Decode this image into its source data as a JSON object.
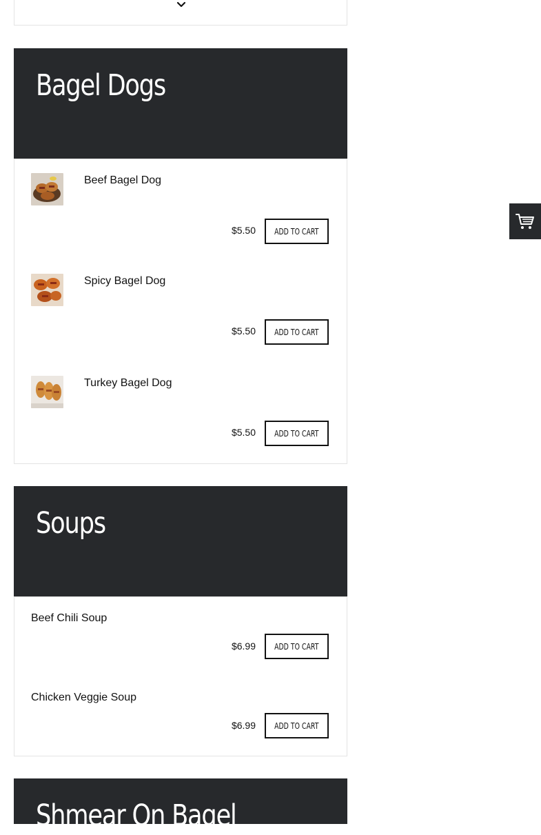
{
  "sections": [
    {
      "title": "Bagel Dogs",
      "items": [
        {
          "name": "Beef Bagel Dog",
          "price": "$5.50",
          "button": "ADD TO CART",
          "thumb": "beef-bagel-dog-thumbnail"
        },
        {
          "name": "Spicy Bagel Dog",
          "price": "$5.50",
          "button": "ADD TO CART",
          "thumb": "spicy-bagel-dog-thumbnail"
        },
        {
          "name": "Turkey Bagel Dog",
          "price": "$5.50",
          "button": "ADD TO CART",
          "thumb": "turkey-bagel-dog-thumbnail"
        }
      ]
    },
    {
      "title": "Soups",
      "items": [
        {
          "name": "Beef Chili Soup",
          "price": "$6.99",
          "button": "ADD TO CART"
        },
        {
          "name": "Chicken Veggie Soup",
          "price": "$6.99",
          "button": "ADD TO CART"
        }
      ]
    },
    {
      "title": "Shmear On Bagel"
    }
  ],
  "icons": {
    "expand": "chevron-down-icon",
    "cart": "shopping-cart-icon"
  },
  "colors": {
    "header_bg": "#27292c",
    "header_text": "#ffffff",
    "border": "#e3e3e3",
    "button_border": "#111111"
  }
}
